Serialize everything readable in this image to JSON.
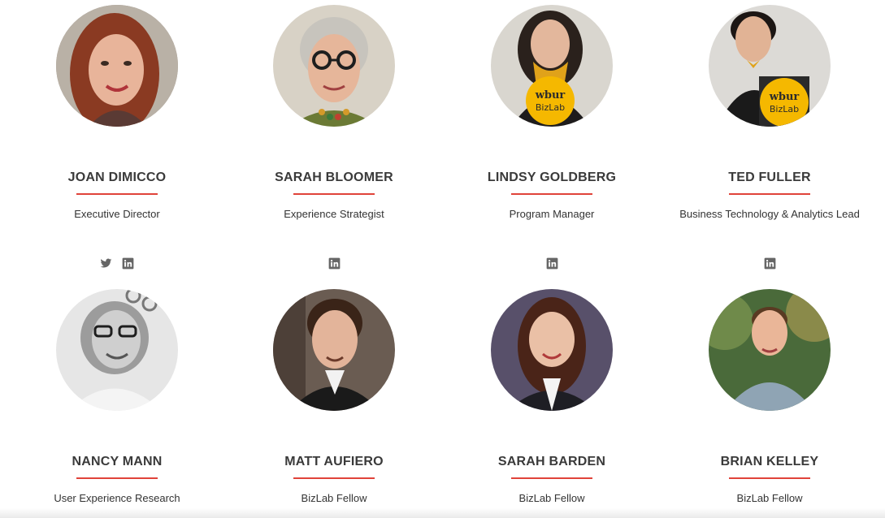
{
  "team": [
    {
      "name": "JOAN DIMICCO",
      "role": "Executive Director",
      "social": [
        "twitter-icon",
        "linkedin-icon"
      ],
      "photo": "portrait of woman with red hair"
    },
    {
      "name": "SARAH BLOOMER",
      "role": "Experience Strategist",
      "social": [
        "linkedin-icon"
      ],
      "photo": "portrait of woman with gray hair and glasses"
    },
    {
      "name": "LINDSY GOLDBERG",
      "role": "Program Manager",
      "social": [
        "linkedin-icon"
      ],
      "photo": "portrait holding wbur BizLab sign"
    },
    {
      "name": "TED FULLER",
      "role": "Business Technology & Analytics Lead",
      "social": [
        "linkedin-icon"
      ],
      "photo": "portrait holding wbur BizLab sign"
    },
    {
      "name": "NANCY MANN",
      "role": "User Experience Research",
      "social": [],
      "photo": "black and white portrait of woman with glasses"
    },
    {
      "name": "MATT AUFIERO",
      "role": "BizLab Fellow",
      "social": [],
      "photo": "portrait of man in suit"
    },
    {
      "name": "SARAH BARDEN",
      "role": "BizLab Fellow",
      "social": [],
      "photo": "portrait of woman in blazer"
    },
    {
      "name": "BRIAN KELLEY",
      "role": "BizLab Fellow",
      "social": [],
      "photo": "portrait of young man outdoors"
    }
  ],
  "sign": {
    "line1": "wbur",
    "line2": "BizLab"
  },
  "colors": {
    "accent": "#e0433a",
    "icon": "#666666",
    "sign": "#f5b800"
  }
}
